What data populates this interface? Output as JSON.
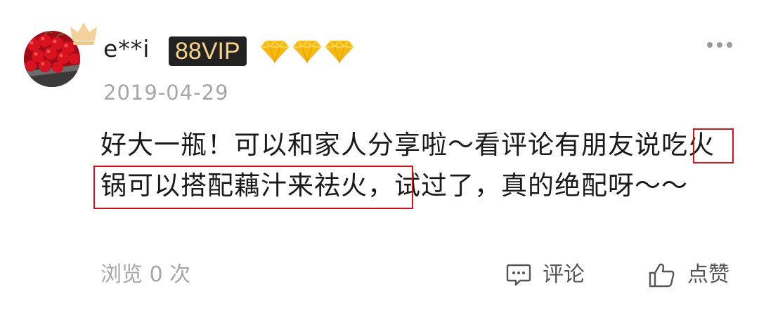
{
  "user": {
    "name": "e**i",
    "vip_label": "88VIP",
    "diamond_count": 3
  },
  "post": {
    "date": "2019-04-29",
    "text": "好大一瓶！可以和家人分享啦～看评论有朋友说吃火锅可以搭配藕汁来祛火，试过了，真的绝配呀～～",
    "highlighted_text": "吃火锅可以搭配藕汁来祛火"
  },
  "footer": {
    "views": "浏览 0 次",
    "comment_label": "评论",
    "like_label": "点赞"
  },
  "colors": {
    "highlight_border": "#d0121b",
    "vip_badge_bg": "#222222",
    "vip_badge_text": "#f5d18a",
    "diamond": "#f6b911",
    "muted_text": "#a6a6a6"
  },
  "icons": {
    "more": "more-icon",
    "comment": "comment-icon",
    "like": "thumbs-up-icon",
    "crown": "crown-icon",
    "diamond": "diamond-icon"
  }
}
